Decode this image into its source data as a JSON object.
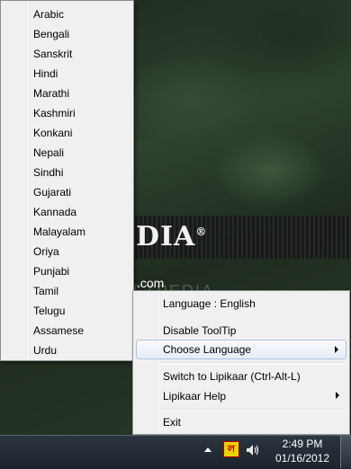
{
  "desktop": {
    "logo_text": "DIA",
    "logo_mark": "®",
    "logo_url": ".com",
    "watermark": "SOFTPEDIA"
  },
  "language_list": {
    "items": [
      "Arabic",
      "Bengali",
      "Sanskrit",
      "Hindi",
      "Marathi",
      "Kashmiri",
      "Konkani",
      "Nepali",
      "Sindhi",
      "Gujarati",
      "Kannada",
      "Malayalam",
      "Oriya",
      "Punjabi",
      "Tamil",
      "Telugu",
      "Assamese",
      "Urdu"
    ]
  },
  "context_menu": {
    "language_status": "Language : English",
    "disable_tooltip": "Disable ToolTip",
    "choose_language": "Choose Language",
    "switch_label": "Switch to Lipikaar (Ctrl-Alt-L)",
    "help": "Lipikaar Help",
    "exit": "Exit"
  },
  "taskbar": {
    "app_glyph": "ল",
    "time": "2:49 PM",
    "date": "01/16/2012"
  },
  "icons": {
    "tray_up": "triangle-up-icon",
    "tray_app": "lipikaar-tray-icon",
    "speaker": "speaker-icon",
    "submenu": "chevron-right-icon"
  }
}
